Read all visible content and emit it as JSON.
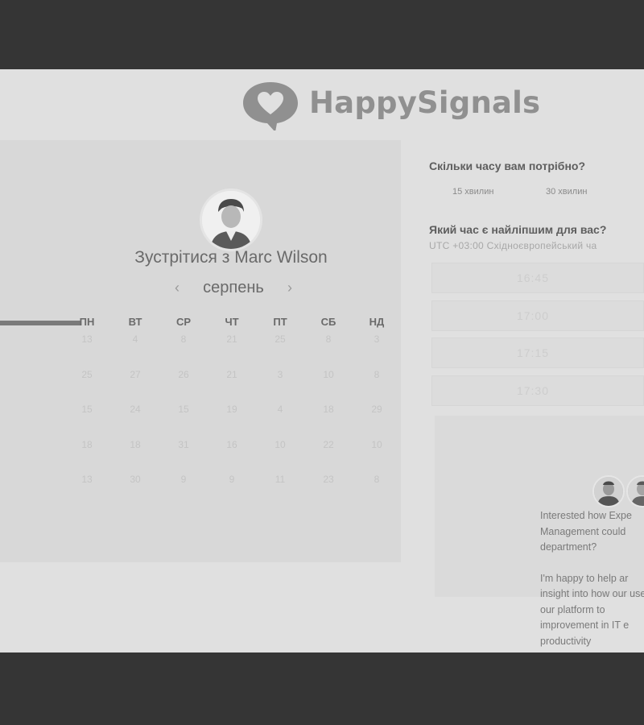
{
  "brand": {
    "name": "HappySignals"
  },
  "host": {
    "title_prefix": "Зустрітися з",
    "name": "Marc Wilson"
  },
  "calendar": {
    "month": "серпень",
    "prev_arrow": "‹",
    "next_arrow": "›",
    "weekdays": [
      "ПН",
      "ВТ",
      "СР",
      "ЧТ",
      "ПТ",
      "СБ",
      "НД"
    ],
    "days": [
      [
        "13",
        "4",
        "8",
        "21",
        "25",
        "8",
        "3"
      ],
      [
        "25",
        "27",
        "26",
        "21",
        "3",
        "10",
        "8"
      ],
      [
        "15",
        "24",
        "15",
        "19",
        "4",
        "18",
        "29"
      ],
      [
        "18",
        "18",
        "31",
        "16",
        "10",
        "22",
        "10"
      ],
      [
        "13",
        "30",
        "9",
        "9",
        "11",
        "23",
        "8"
      ]
    ]
  },
  "duration": {
    "question": "Скільки часу вам потрібно?",
    "options": [
      "15 хвилин",
      "30 хвилин"
    ]
  },
  "time": {
    "question": "Який час є найліпшим для вас?",
    "timezone": "UTC +03:00 Східноєвропейський ча",
    "slots": [
      "16:45",
      "17:00",
      "17:15",
      "17:30"
    ]
  },
  "chat": {
    "paragraph1": "Interested how Expe Management could department?",
    "paragraph2": "I'm happy to help ar insight into how our use our platform to improvement in IT e productivity"
  },
  "colors": {
    "page_bg": "#e0e0e0",
    "panel_bg": "#d8d8d8",
    "frame": "#353535",
    "logo_grey": "#909090"
  }
}
